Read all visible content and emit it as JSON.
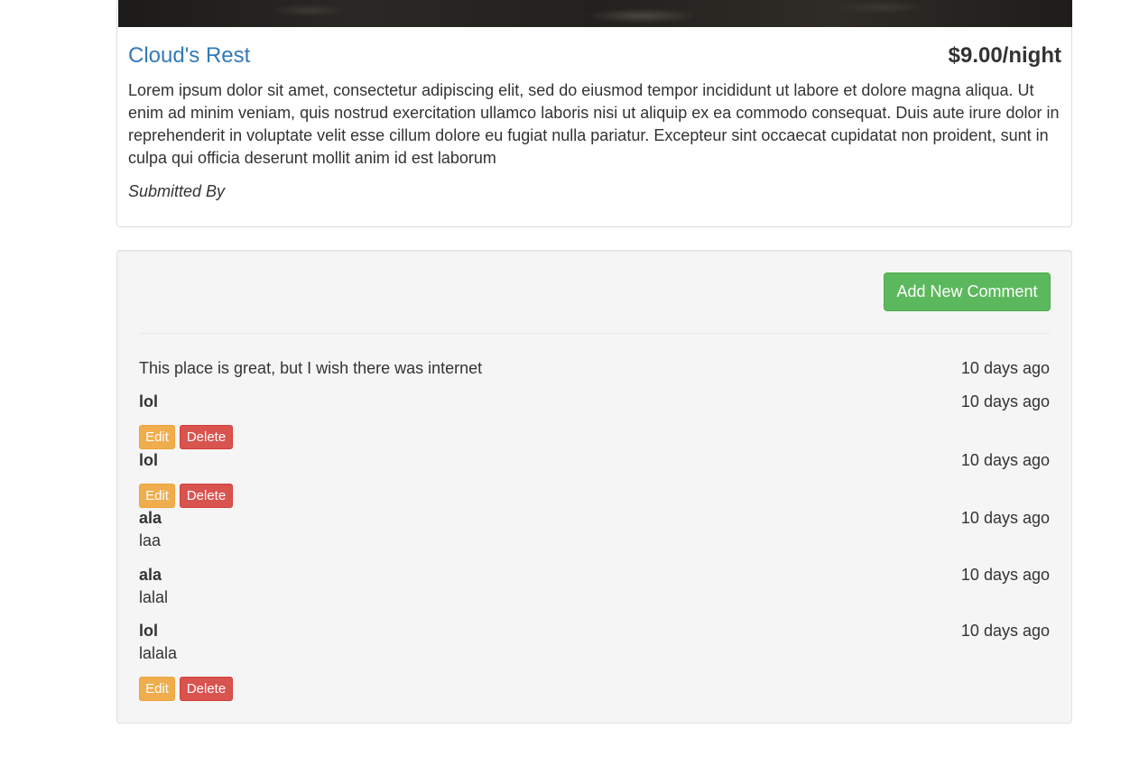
{
  "campground": {
    "name": "Cloud's Rest",
    "price": "$9.00/night",
    "description": "Lorem ipsum dolor sit amet, consectetur adipiscing elit, sed do eiusmod tempor incididunt ut labore et dolore magna aliqua. Ut enim ad minim veniam, quis nostrud exercitation ullamco laboris nisi ut aliquip ex ea commodo consequat. Duis aute irure dolor in reprehenderit in voluptate velit esse cillum dolore eu fugiat nulla pariatur. Excepteur sint occaecat cupidatat non proident, sunt in culpa qui officia deserunt mollit anim id est laborum",
    "submitted_by": "Submitted By"
  },
  "comments_section": {
    "add_button_label": "Add New Comment",
    "edit_label": "Edit",
    "delete_label": "Delete",
    "comments": [
      {
        "author": "",
        "text": "This place is great, but I wish there was internet",
        "time": "10 days ago"
      },
      {
        "author": "lol",
        "text": "",
        "time": "10 days ago"
      },
      {
        "author": "lol",
        "text": "",
        "time": "10 days ago"
      },
      {
        "author": "ala",
        "text": "laa",
        "time": "10 days ago"
      },
      {
        "author": "ala",
        "text": "lalal",
        "time": "10 days ago"
      },
      {
        "author": "lol",
        "text": "lalala",
        "time": "10 days ago"
      }
    ]
  },
  "colors": {
    "link": "#337ab7",
    "success": "#5cb85c",
    "warning": "#f0ad4e",
    "danger": "#d9534f",
    "well_background": "#f5f5f5"
  }
}
